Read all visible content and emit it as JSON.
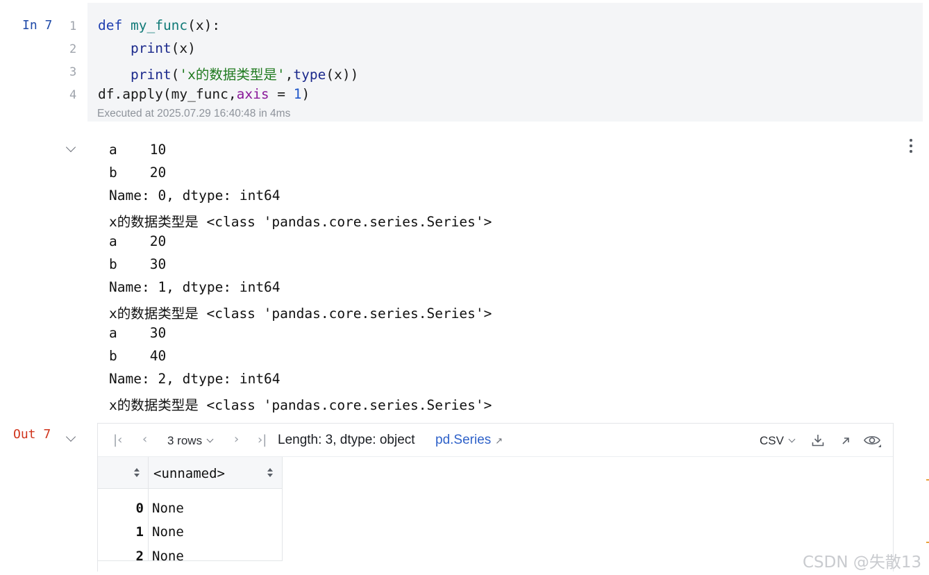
{
  "input_cell": {
    "label": "In 7",
    "line_numbers": [
      "1",
      "2",
      "3",
      "4"
    ],
    "code": {
      "l1": {
        "kw": "def",
        "fn": "my_func",
        "rest": "(x):"
      },
      "l2": {
        "indent": "    ",
        "bi": "print",
        "rest": "(x)"
      },
      "l3": {
        "indent": "    ",
        "bi": "print",
        "open": "(",
        "str": "'x的数据类型是'",
        "comma": ",",
        "bi2": "type",
        "rest": "(x))"
      },
      "l4": {
        "pre": "df.apply(my_func,",
        "kwarg": "axis",
        "eq": " = ",
        "num": "1",
        "close": ")"
      }
    },
    "executed": "Executed at 2025.07.29 16:40:48 in 4ms"
  },
  "stdout": [
    "a    10",
    "b    20",
    "Name: 0, dtype: int64",
    "x的数据类型是 <class 'pandas.core.series.Series'>",
    "a    20",
    "b    30",
    "Name: 1, dtype: int64",
    "x的数据类型是 <class 'pandas.core.series.Series'>",
    "a    30",
    "b    40",
    "Name: 2, dtype: int64",
    "x的数据类型是 <class 'pandas.core.series.Series'>"
  ],
  "output_cell": {
    "label": "Out 7",
    "toolbar": {
      "first_icon": "first-page-icon",
      "prev_icon": "prev-page-icon",
      "rows": "3 rows",
      "next_icon": "next-page-icon",
      "last_icon": "last-page-icon",
      "info": "Length: 3, dtype: object",
      "type_link": "pd.Series",
      "export_format": "CSV"
    },
    "table": {
      "column": "<unnamed>",
      "rows": [
        {
          "index": "0",
          "value": "None"
        },
        {
          "index": "1",
          "value": "None"
        },
        {
          "index": "2",
          "value": "None"
        }
      ]
    }
  },
  "watermark": "CSDN @失散13"
}
